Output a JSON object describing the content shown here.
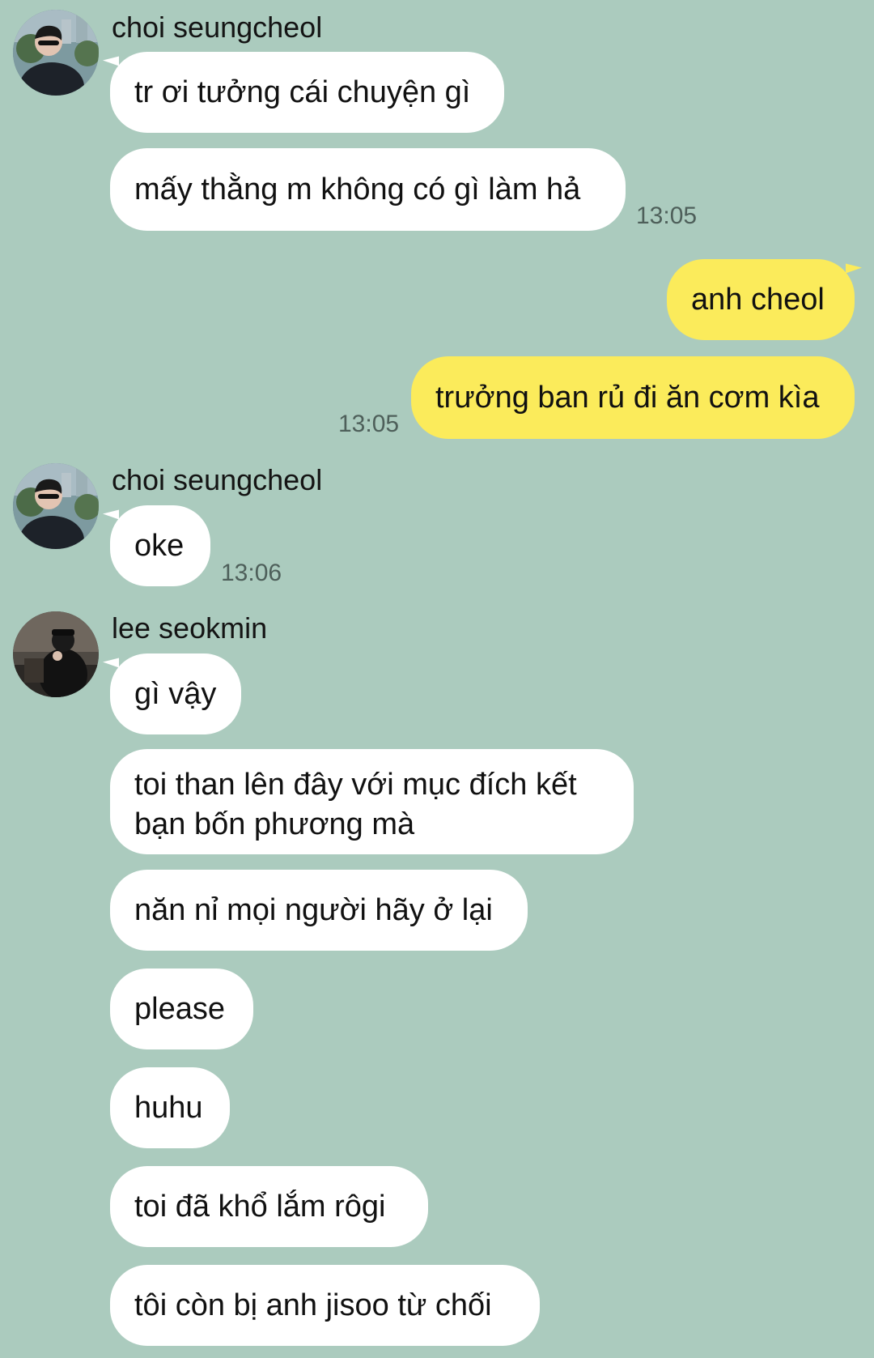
{
  "colors": {
    "background": "#abcbbe",
    "incoming_bubble": "#ffffff",
    "outgoing_bubble": "#fbeb5b",
    "timestamp": "#4e5f5a"
  },
  "messages": {
    "group1": {
      "sender": "choi seungcheol",
      "avatar_icon": "user-avatar-icon",
      "texts": [
        "tr ơi tưởng cái chuyện gì",
        "mấy thằng m không có gì làm hả"
      ],
      "time": "13:05"
    },
    "group2": {
      "sender": "me",
      "texts": [
        "anh cheol",
        "trưởng ban rủ đi ăn cơm kìa"
      ],
      "time": "13:05"
    },
    "group3": {
      "sender": "choi seungcheol",
      "avatar_icon": "user-avatar-icon",
      "texts": [
        "oke"
      ],
      "time": "13:06"
    },
    "group4": {
      "sender": "lee seokmin",
      "avatar_icon": "user-avatar-icon",
      "texts": [
        "gì vậy",
        "toi than lên đây với mục đích kết bạn bốn phương mà",
        "năn nỉ mọi người hãy ở lại",
        "please",
        "huhu",
        "toi đã khổ lắm rôgi",
        "tôi còn bị anh jisoo từ chối"
      ]
    }
  }
}
